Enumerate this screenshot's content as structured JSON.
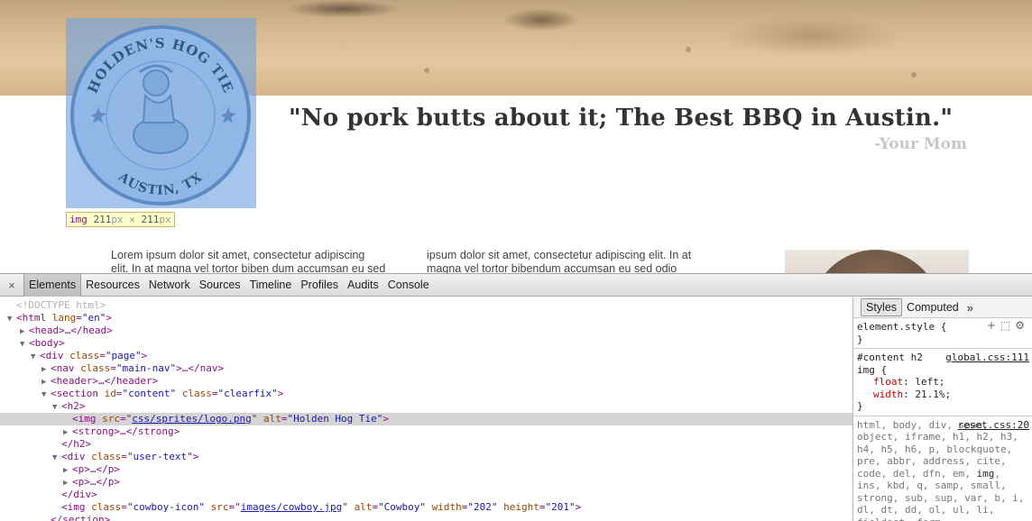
{
  "page": {
    "logo_text_top": "HOLDEN'S HOG TIE",
    "logo_text_bottom": "AUSTIN, TX",
    "logo_size_tag": "img",
    "logo_size_w": "211",
    "logo_size_h": "211",
    "logo_size_unit": "px",
    "logo_size_sep": "×",
    "quote": "\"No pork butts about it; The Best BBQ in Austin.\"",
    "quote_by": "-Your Mom",
    "col1_line1": "Lorem ipsum dolor sit amet, consectetur adipiscing",
    "col1_line2": "elit. In at magna vel tortor biben dum accumsan eu sed",
    "col2_line1": "ipsum dolor sit amet, consectetur adipiscing elit. In at",
    "col2_line2": "magna vel tortor bibendum accumsan eu sed odio"
  },
  "devtools": {
    "close": "×",
    "tabs": [
      "Elements",
      "Resources",
      "Network",
      "Sources",
      "Timeline",
      "Profiles",
      "Audits",
      "Console"
    ],
    "active_tab": "Elements",
    "dom": {
      "l0": "<!DOCTYPE html>",
      "l1_tag": "html",
      "l1_attr": "lang",
      "l1_val": "\"en\"",
      "l2": "<head>…</head>",
      "l3": "<body>",
      "l4_tag": "div",
      "l4_attr": "class",
      "l4_val": "\"page\"",
      "l5_tag": "nav",
      "l5_attr": "class",
      "l5_val": "\"main-nav\"",
      "l5_tail": ">…</nav>",
      "l6": "<header>…</header>",
      "l7_tag": "section",
      "l7_attr1": "id",
      "l7_val1": "\"content\"",
      "l7_attr2": "class",
      "l7_val2": "\"clearfix\"",
      "l8": "<h2>",
      "l9_tag": "img",
      "l9_attr1": "src",
      "l9_val1": "css/sprites/logo.png",
      "l9_attr2": "alt",
      "l9_val2": "\"Holden Hog Tie\"",
      "l10": "<strong>…</strong>",
      "l11": "</h2>",
      "l12_tag": "div",
      "l12_attr": "class",
      "l12_val": "\"user-text\"",
      "l13": "<p>…</p>",
      "l14": "<p>…</p>",
      "l15": "</div>",
      "l16_tag": "img",
      "l16_attr1": "class",
      "l16_val1": "\"cowboy-icon\"",
      "l16_attr2": "src",
      "l16_val2": "images/cowboy.jpg",
      "l16_attr3": "alt",
      "l16_val3": "\"Cowboy\"",
      "l16_attr4": "width",
      "l16_val4": "\"202\"",
      "l16_attr5": "height",
      "l16_val5": "\"201\"",
      "l17": "</section>"
    },
    "styles": {
      "tabs": [
        "Styles",
        "Computed"
      ],
      "more": "»",
      "element_style": "element.style {",
      "close_brace": "}",
      "rule1_selector": "#content h2",
      "rule1_selector2": "img {",
      "rule1_src": "global.css:111",
      "rule1_p1_name": "float",
      "rule1_p1_val": "left;",
      "rule1_p2_name": "width",
      "rule1_p2_val": "21.1%;",
      "rule2_src": "reset.css:20",
      "rule2_selectors": "html, body, div, span, object, iframe, h1, h2, h3, h4, h5, h6, p, blockquote, pre, abbr, address, cite, code, del, dfn, em,",
      "rule2_match": "img",
      "rule2_selectors_b": ", ins, kbd, q, samp, small, strong, sub, sup, var, b, i, dl, dt, dd, ol, ul, li, fieldset, form,"
    }
  }
}
